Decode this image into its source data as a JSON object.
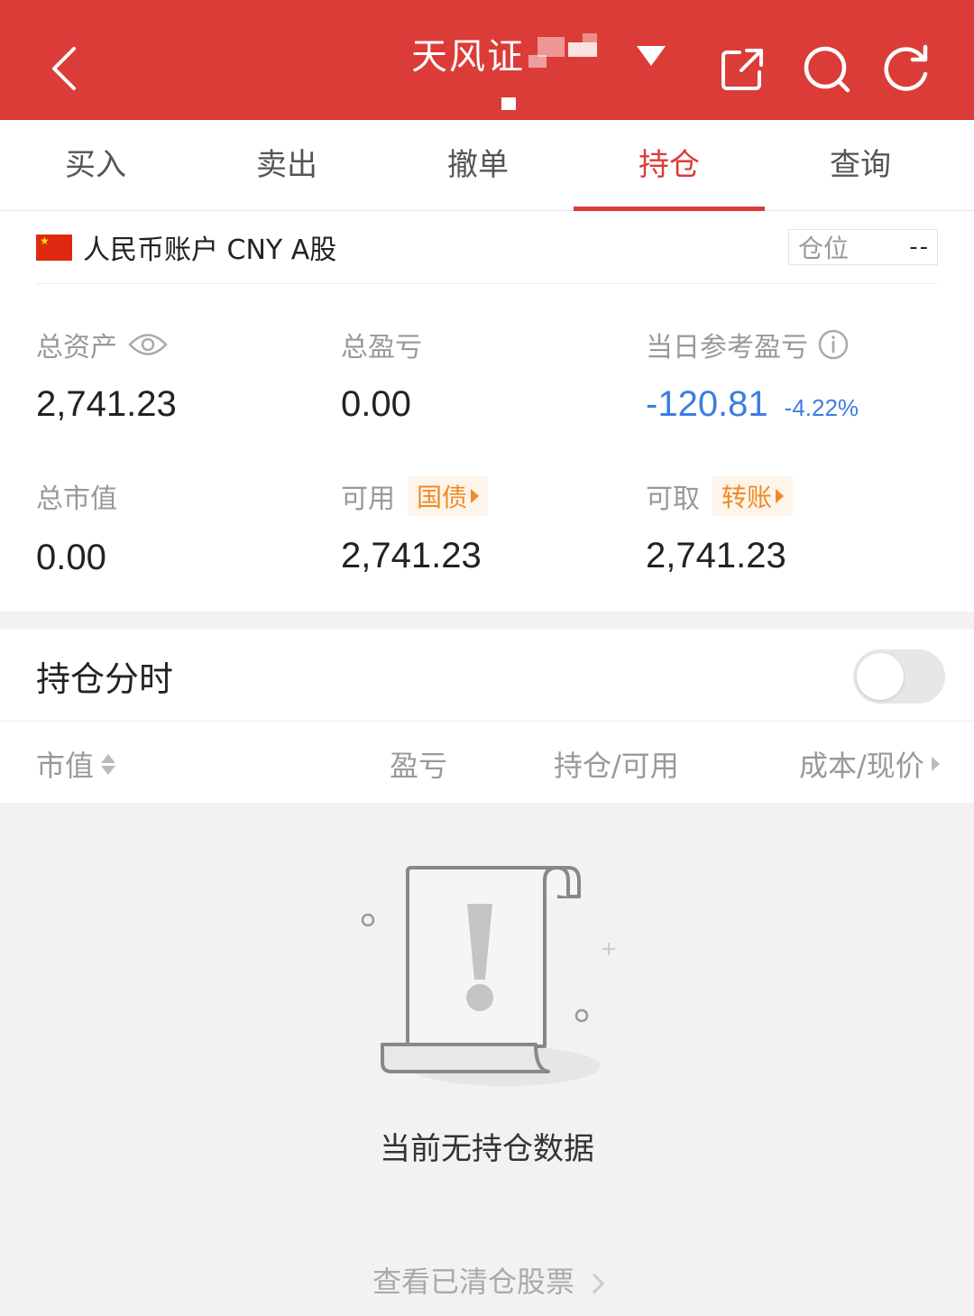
{
  "header": {
    "title": "天风证",
    "colors": {
      "brand": "#db3c38",
      "negative": "#3b7ee0",
      "chip": "#f08a24"
    },
    "icons": [
      "back-arrow-icon",
      "share-icon",
      "search-icon",
      "refresh-icon"
    ]
  },
  "tabs": [
    {
      "label": "买入",
      "active": false
    },
    {
      "label": "卖出",
      "active": false
    },
    {
      "label": "撤单",
      "active": false
    },
    {
      "label": "持仓",
      "active": true
    },
    {
      "label": "查询",
      "active": false
    }
  ],
  "account": {
    "name": "人民币账户 CNY A股",
    "position_label": "仓位",
    "position_value": "--"
  },
  "stats": {
    "total_assets": {
      "label": "总资产",
      "value": "2,741.23"
    },
    "total_pnl": {
      "label": "总盈亏",
      "value": "0.00"
    },
    "daily_pnl": {
      "label": "当日参考盈亏",
      "value": "-120.81",
      "pct": "-4.22%"
    },
    "market_value": {
      "label": "总市值",
      "value": "0.00"
    },
    "available": {
      "label": "可用",
      "chip": "国债",
      "value": "2,741.23"
    },
    "withdrawable": {
      "label": "可取",
      "chip": "转账",
      "value": "2,741.23"
    }
  },
  "holdings_section": {
    "title": "持仓分时",
    "toggle_on": false
  },
  "columns": {
    "market_value": "市值",
    "pnl": "盈亏",
    "holding": "持仓/可用",
    "cost": "成本/现价"
  },
  "empty": {
    "message": "当前无持仓数据",
    "cleared_link": "查看已清仓股票"
  }
}
